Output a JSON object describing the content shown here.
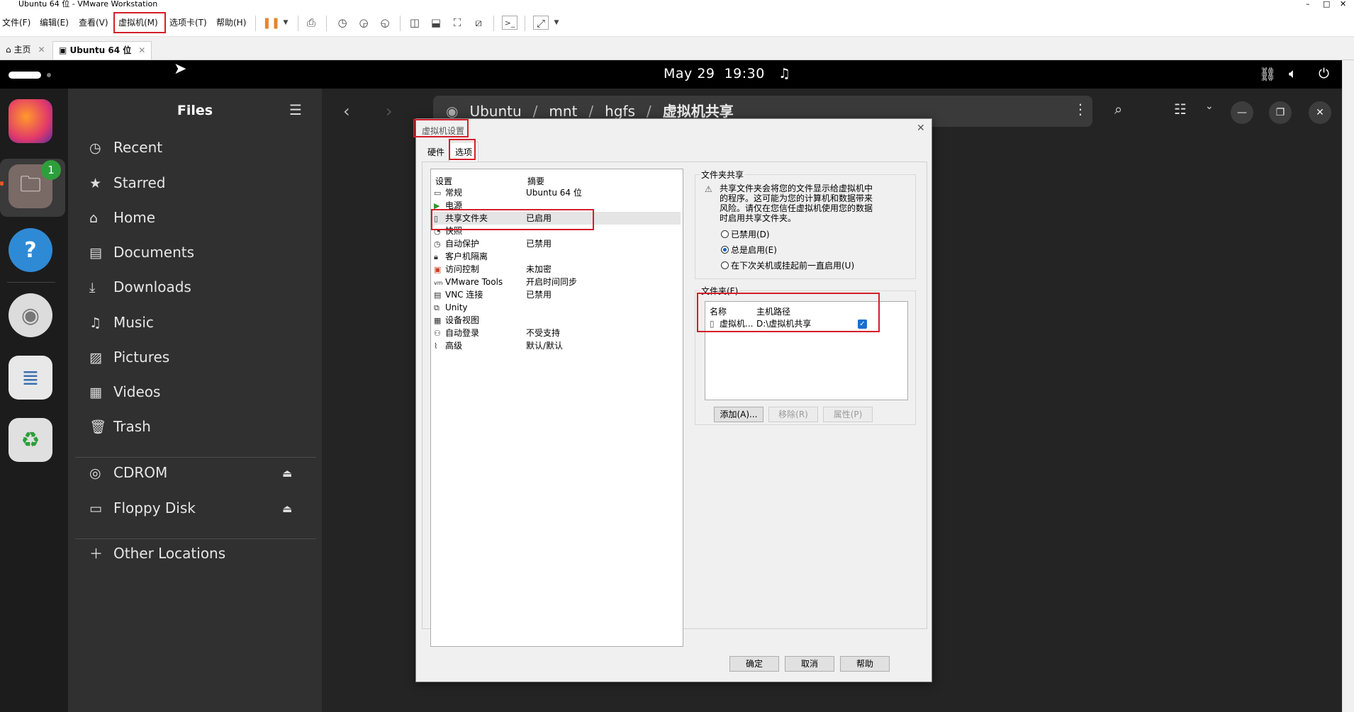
{
  "window": {
    "title": "Ubuntu 64 位 - VMware Workstation",
    "controls": [
      "–",
      "□",
      "✕"
    ]
  },
  "vmware_menu": [
    "文件(F)",
    "编辑(E)",
    "查看(V)",
    "虚拟机(M)",
    "选项卡(T)",
    "帮助(H)"
  ],
  "vmware_tabs": [
    {
      "label": "主页"
    },
    {
      "label": "Ubuntu 64 位"
    }
  ],
  "ubuntu_topbar": {
    "date": "May 29",
    "time": "19:30"
  },
  "dock": {
    "badge": "1"
  },
  "files": {
    "title": "Files",
    "places": [
      "Recent",
      "Starred",
      "Home",
      "Documents",
      "Downloads",
      "Music",
      "Pictures",
      "Videos",
      "Trash"
    ],
    "devices": [
      "CDROM",
      "Floppy Disk"
    ],
    "other": "Other Locations",
    "path": [
      "Ubuntu",
      "mnt",
      "hgfs",
      "虚拟机共享"
    ]
  },
  "dialog": {
    "title": "虚拟机设置",
    "tabs": [
      "硬件",
      "选项"
    ],
    "list_headers": {
      "setting": "设置",
      "summary": "摘要"
    },
    "settings": [
      {
        "name": "常规",
        "summary": "Ubuntu 64 位",
        "icon": "general-icon"
      },
      {
        "name": "电源",
        "summary": "",
        "icon": "power-icon"
      },
      {
        "name": "共享文件夹",
        "summary": "已启用",
        "icon": "shared-folder-icon"
      },
      {
        "name": "快照",
        "summary": "",
        "icon": "snapshot-icon"
      },
      {
        "name": "自动保护",
        "summary": "已禁用",
        "icon": "autoprotect-icon"
      },
      {
        "name": "客户机隔离",
        "summary": "",
        "icon": "lock-icon"
      },
      {
        "name": "访问控制",
        "summary": "未加密",
        "icon": "access-control-icon"
      },
      {
        "name": "VMware Tools",
        "summary": "开启时间同步",
        "icon": "vmware-tools-icon"
      },
      {
        "name": "VNC 连接",
        "summary": "已禁用",
        "icon": "vnc-icon"
      },
      {
        "name": "Unity",
        "summary": "",
        "icon": "unity-icon"
      },
      {
        "name": "设备视图",
        "summary": "",
        "icon": "device-view-icon"
      },
      {
        "name": "自动登录",
        "summary": "不受支持",
        "icon": "autologin-icon"
      },
      {
        "name": "高级",
        "summary": "默认/默认",
        "icon": "advanced-icon"
      }
    ],
    "folder_sharing": {
      "label": "文件夹共享",
      "warning": "共享文件夹会将您的文件显示给虚拟机中的程序。这可能为您的计算机和数据带来风险。请仅在您信任虚拟机使用您的数据时启用共享文件夹。",
      "warning_lines": [
        "共享文件夹会将您的文件显示给虚拟机中",
        "的程序。这可能为您的计算机和数据带来",
        "风险。请仅在您信任虚拟机使用您的数据",
        "时启用共享文件夹。"
      ],
      "options": [
        "已禁用(D)",
        "总是启用(E)",
        "在下次关机或挂起前一直启用(U)"
      ],
      "selected": "总是启用(E)"
    },
    "folders": {
      "label": "文件夹(F)",
      "headers": {
        "name": "名称",
        "host_path": "主机路径"
      },
      "rows": [
        {
          "name": "虚拟机...",
          "host_path": "D:\\虚拟机共享",
          "enabled": true
        }
      ],
      "buttons": {
        "add": "添加(A)...",
        "remove": "移除(R)",
        "properties": "属性(P)"
      }
    },
    "footer": {
      "ok": "确定",
      "cancel": "取消",
      "help": "帮助"
    }
  },
  "colors": {
    "highlight": "#d41e2a",
    "ubuntu_orange": "#e95420",
    "badge": "#2e9e3a"
  }
}
